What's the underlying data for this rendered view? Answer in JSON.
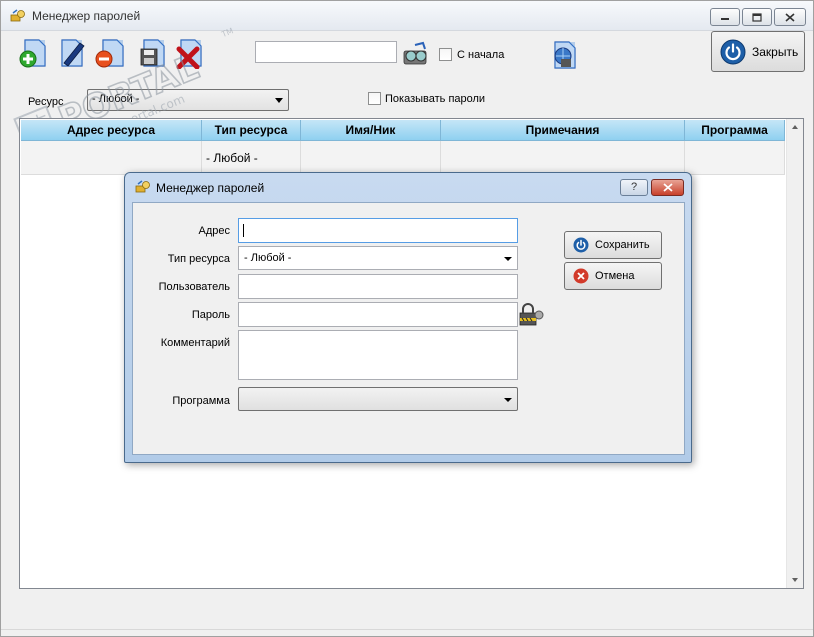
{
  "window": {
    "title": "Менеджер паролей"
  },
  "toolbar": {
    "icons": [
      "add-icon",
      "edit-icon",
      "delete-icon",
      "save-icon",
      "clear-icon",
      "find-icon",
      "export-icon"
    ],
    "search_value": "",
    "from_start_label": "С начала",
    "close_label": "Закрыть"
  },
  "filter": {
    "resource_label": "Ресурс",
    "resource_value": "- Любой -",
    "show_passwords_label": "Показывать пароли"
  },
  "watermark": {
    "main": "PORTAL",
    "site": "www.softportal.com",
    "tm": "TM"
  },
  "table": {
    "columns": [
      "Адрес ресурса",
      "Тип ресурса",
      "Имя/Ник",
      "Примечания",
      "Программа"
    ],
    "rows": [
      [
        "",
        "- Любой -",
        "",
        "",
        ""
      ]
    ]
  },
  "dialog": {
    "title": "Менеджер паролей",
    "help_label": "?",
    "address_label": "Адрес",
    "address_value": "",
    "type_label": "Тип ресурса",
    "type_value": "- Любой -",
    "user_label": "Пользователь",
    "user_value": "",
    "password_label": "Пароль",
    "password_value": "",
    "comment_label": "Комментарий",
    "comment_value": "",
    "program_label": "Программа",
    "program_value": "",
    "save_label": "Сохранить",
    "cancel_label": "Отмена"
  },
  "colors": {
    "header_top": "#c5e6f7",
    "header_bottom": "#8fd0f0",
    "close_accent": "#1e5fa8",
    "dialog_frame": "#b1cbe8"
  }
}
